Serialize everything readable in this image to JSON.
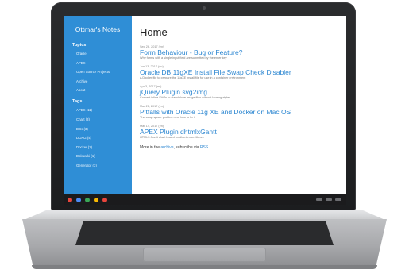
{
  "site": {
    "title": "Ottmar's Notes"
  },
  "sidebar": {
    "topics_heading": "Topics",
    "topics": [
      "Oracle",
      "APEX",
      "Open Source Projects",
      "Archive",
      "About"
    ],
    "tags_heading": "Tags",
    "tags": [
      "APEX (11)",
      "Chart (3)",
      "DCs (3)",
      "DOAG (4)",
      "Docker (2)",
      "Dokuwiki (1)",
      "Generator (3)"
    ]
  },
  "main": {
    "page_title": "Home",
    "posts": [
      {
        "date": "Sep 26, 2017 (en)",
        "title": "Form Behaviour - Bug or Feature?",
        "desc": "Why forms with a single input field are submitted by the enter key"
      },
      {
        "date": "Jun 13, 2017 (en)",
        "title": "Oracle DB 11gXE Install File Swap Check Disabler",
        "desc": "A Docker file to prepare the 11gXE install file for use in a container environment"
      },
      {
        "date": "Apr 3, 2017 (en)",
        "title": "jQuery Plugin svg2img",
        "desc": "Convert inline SVGs to standalone image files without loosing styles"
      },
      {
        "date": "Mar 21, 2017 (en)",
        "title": "Pitfalls with Oracle 11g XE and Docker on Mac OS",
        "desc": "The swap space problem and how to fix it"
      },
      {
        "date": "Mar 14, 2017 (en)",
        "title": "APEX Plugin dhtmlxGantt",
        "desc": "HTML5 Gantt chart based on dhtmlx.com library"
      }
    ],
    "footer": {
      "prefix": "More in the ",
      "archive_link": "archive",
      "middle": ", subscribe via ",
      "rss_link": "RSS"
    }
  },
  "taskbar": {
    "icon_colors": [
      "#e8453c",
      "#4c8bf5",
      "#3aa757",
      "#f6b704",
      "#e8453c"
    ]
  }
}
